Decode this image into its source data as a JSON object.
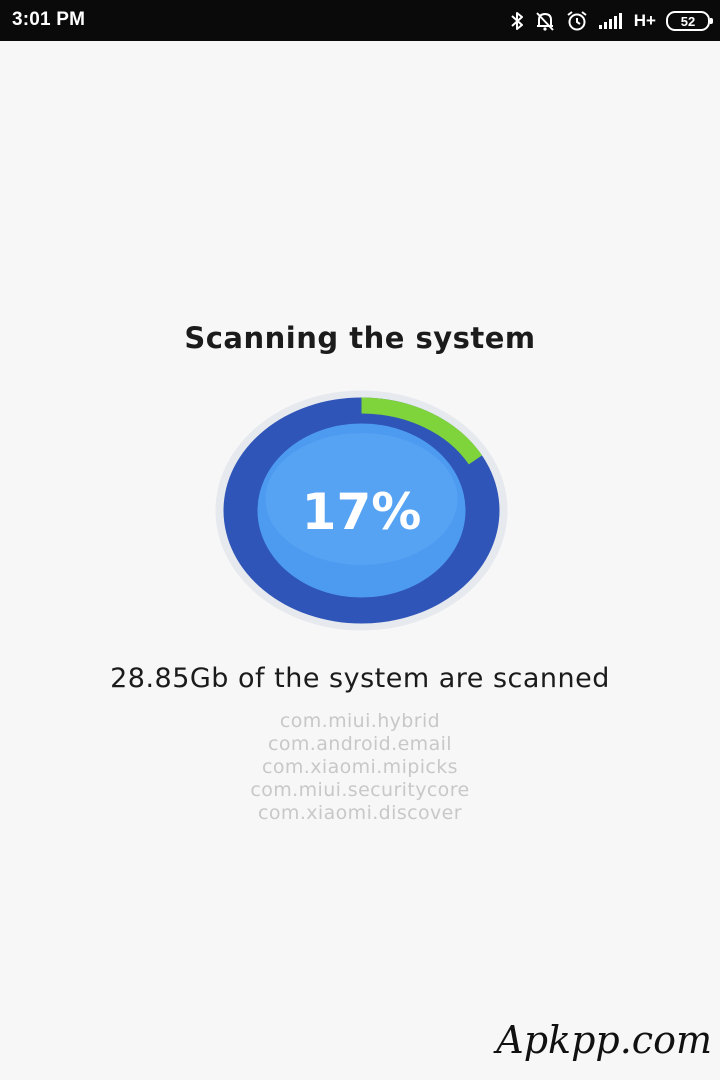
{
  "status_bar": {
    "time": "3:01 PM",
    "network_type": "H+",
    "battery_level": "52",
    "icons": [
      "bluetooth-icon",
      "notifications-off-icon",
      "alarm-icon",
      "signal-strength-icon",
      "battery-icon"
    ]
  },
  "main": {
    "title": "Scanning the system",
    "progress": {
      "label": "17%",
      "value": 0.17,
      "track_color": "#2f55b9",
      "inner_color": "#4d9bf1",
      "fill_color": "#7ed43a"
    },
    "scanned_text": "28.85Gb of the system are scanned",
    "packages": [
      "com.miui.hybrid",
      "com.android.email",
      "com.xiaomi.mipicks",
      "com.miui.securitycore",
      "com.xiaomi.discover"
    ]
  },
  "watermark": "Apkpp.com"
}
